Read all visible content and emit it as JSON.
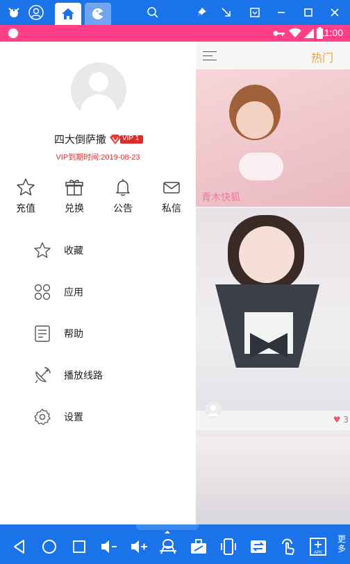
{
  "status_bar": {
    "time": "11:00"
  },
  "content": {
    "header_tab": "热门",
    "card1_caption": "青木快狐",
    "card2_likes": "3"
  },
  "drawer": {
    "username": "四大倒萨撒",
    "vip_label": "VIP 1",
    "vip_expiry": "VIP到期时间:2019-08-23",
    "quick_actions": [
      {
        "icon": "star-icon",
        "label": "充值"
      },
      {
        "icon": "gift-icon",
        "label": "兑换"
      },
      {
        "icon": "bell-icon",
        "label": "公告"
      },
      {
        "icon": "mail-icon",
        "label": "私信"
      }
    ],
    "menu": [
      {
        "icon": "star-icon",
        "label": "收藏"
      },
      {
        "icon": "apps-icon",
        "label": "应用"
      },
      {
        "icon": "document-icon",
        "label": "帮助"
      },
      {
        "icon": "satellite-icon",
        "label": "播放线路"
      },
      {
        "icon": "settings-icon",
        "label": "设置"
      }
    ]
  },
  "emulator": {
    "more_label": "更多",
    "apk_label": "APK"
  },
  "colors": {
    "status_bar": "#ff3f8a",
    "emulator_chrome": "#1a73e8",
    "vip_red": "#e02b2b",
    "accent_hot": "#e8a34a"
  }
}
